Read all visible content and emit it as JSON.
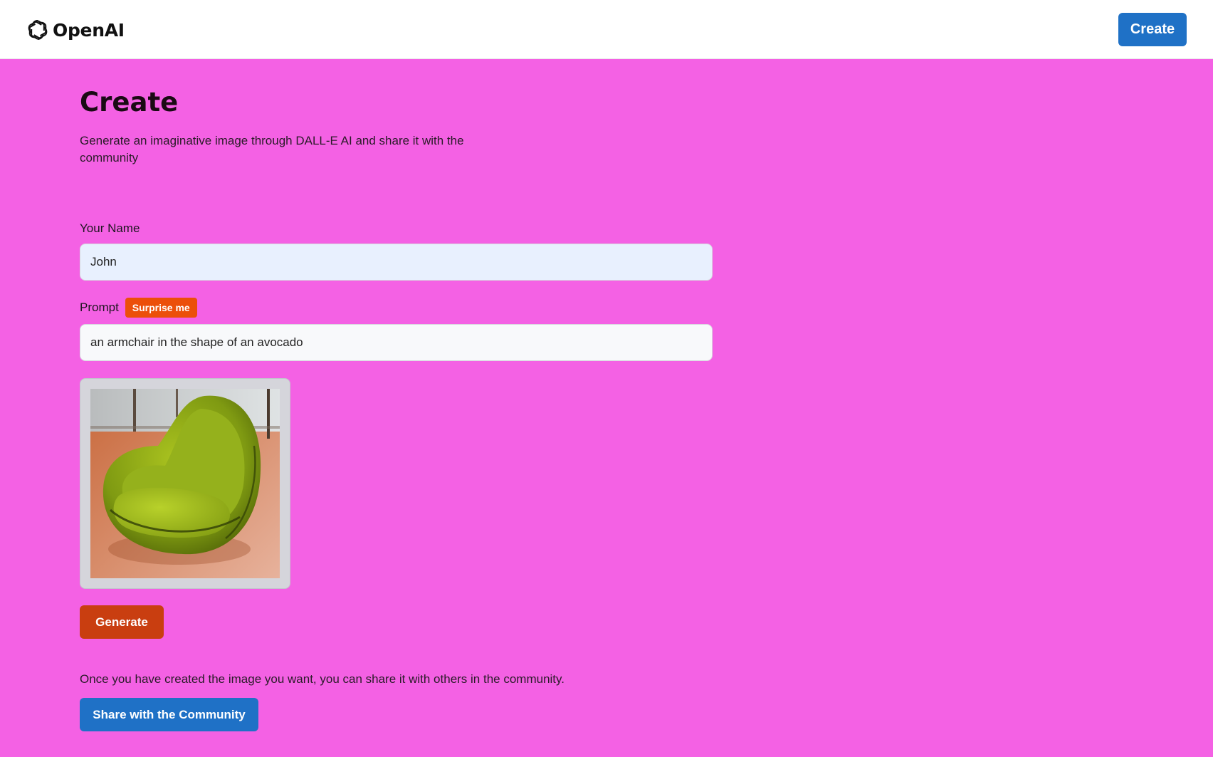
{
  "header": {
    "logo_icon": "openai-logo-icon",
    "logo_text": "OpenAI",
    "create_label": "Create"
  },
  "page": {
    "title": "Create",
    "description": "Generate an imaginative image through DALL-E AI and share it with the community"
  },
  "form": {
    "name_label": "Your Name",
    "name_value": "John",
    "prompt_label": "Prompt",
    "surprise_label": "Surprise me",
    "prompt_value": "an armchair in the shape of an avocado",
    "generate_label": "Generate"
  },
  "share": {
    "note": "Once you have created the image you want, you can share it with others in the community.",
    "button_label": "Share with the Community"
  },
  "colors": {
    "background": "#f461e4",
    "primary_blue": "#1f71c6",
    "generate_orange": "#c93e10",
    "surprise_orange": "#ec4f0a"
  }
}
